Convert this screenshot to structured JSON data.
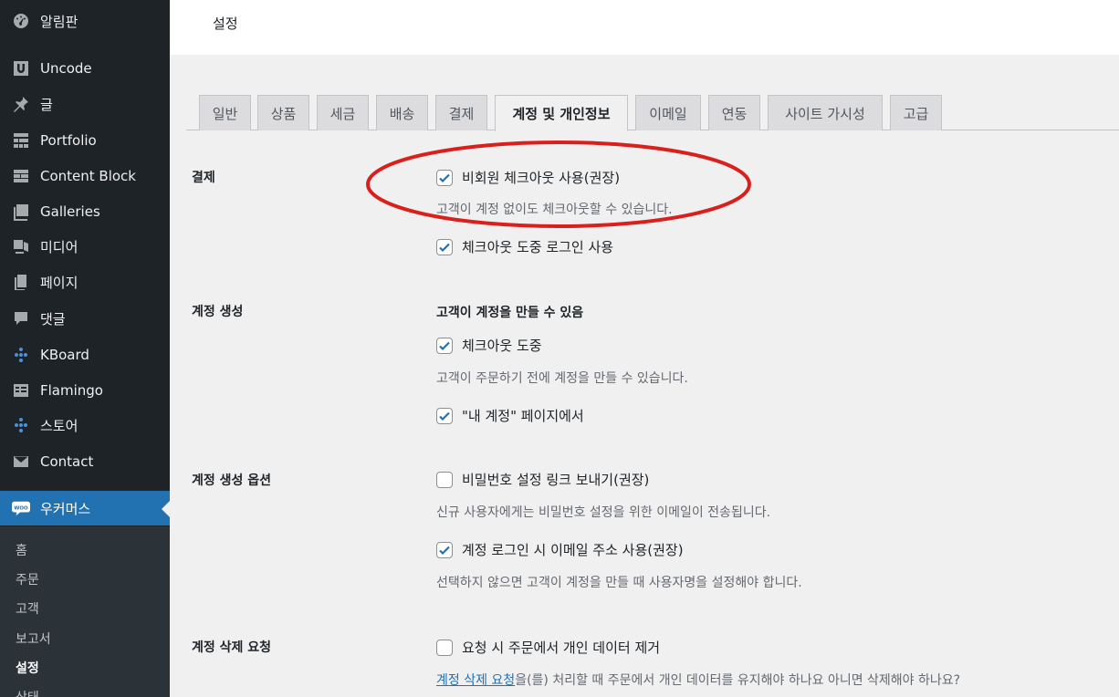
{
  "sidebar": {
    "items": [
      {
        "label": "알림판",
        "icon": "dashboard-icon"
      },
      {
        "label": "Uncode",
        "icon": "uncode-icon"
      },
      {
        "label": "글",
        "icon": "pin-icon"
      },
      {
        "label": "Portfolio",
        "icon": "portfolio-icon"
      },
      {
        "label": "Content Block",
        "icon": "content-block-icon"
      },
      {
        "label": "Galleries",
        "icon": "galleries-icon"
      },
      {
        "label": "미디어",
        "icon": "media-icon"
      },
      {
        "label": "페이지",
        "icon": "pages-icon"
      },
      {
        "label": "댓글",
        "icon": "comments-icon"
      },
      {
        "label": "KBoard",
        "icon": "kboard-icon"
      },
      {
        "label": "Flamingo",
        "icon": "flamingo-icon"
      },
      {
        "label": "스토어",
        "icon": "store-icon"
      },
      {
        "label": "Contact",
        "icon": "mail-icon"
      },
      {
        "label": "우커머스",
        "icon": "woo-icon"
      }
    ],
    "woo_badge": "WOO",
    "submenu": [
      "홈",
      "주문",
      "고객",
      "보고서",
      "설정",
      "상태"
    ]
  },
  "header": {
    "title": "설정"
  },
  "tabs": [
    "일반",
    "상품",
    "세금",
    "배송",
    "결제",
    "계정 및 개인정보",
    "이메일",
    "연동",
    "사이트 가시성",
    "고급"
  ],
  "active_tab": "계정 및 개인정보",
  "sections": {
    "checkout": {
      "label": "결제",
      "guest_checkout": {
        "label": "비회원 체크아웃 사용(권장)",
        "checked": true,
        "desc": "고객이 계정 없이도 체크아웃할 수 있습니다."
      },
      "login_during_checkout": {
        "label": "체크아웃 도중 로그인 사용",
        "checked": true
      }
    },
    "account_creation": {
      "label": "계정 생성",
      "heading": "고객이 계정을 만들 수 있음",
      "during_checkout": {
        "label": "체크아웃 도중",
        "checked": true,
        "desc": "고객이 주문하기 전에 계정을 만들 수 있습니다."
      },
      "my_account_page": {
        "label": "\"내 계정\" 페이지에서",
        "checked": true
      }
    },
    "account_creation_options": {
      "label": "계정 생성 옵션",
      "send_password_link": {
        "label": "비밀번호 설정 링크 보내기(권장)",
        "checked": false,
        "desc": "신규 사용자에게는 비밀번호 설정을 위한 이메일이 전송됩니다."
      },
      "email_as_username": {
        "label": "계정 로그인 시 이메일 주소 사용(권장)",
        "checked": true,
        "desc": "선택하지 않으면 고객이 계정을 만들 때 사용자명을 설정해야 합니다."
      }
    },
    "erasure": {
      "label": "계정 삭제 요청",
      "remove_order_data": {
        "label": "요청 시 주문에서 개인 데이터 제거",
        "checked": false
      },
      "desc_link": "계정 삭제 요청",
      "desc_rest": "을(를) 처리할 때 주문에서 개인 데이터를 유지해야 하나요 아니면 삭제해야 하나요?"
    }
  },
  "colors": {
    "sidebar_bg": "#1d2327",
    "accent": "#2271b1",
    "annotation": "#d9201c"
  }
}
